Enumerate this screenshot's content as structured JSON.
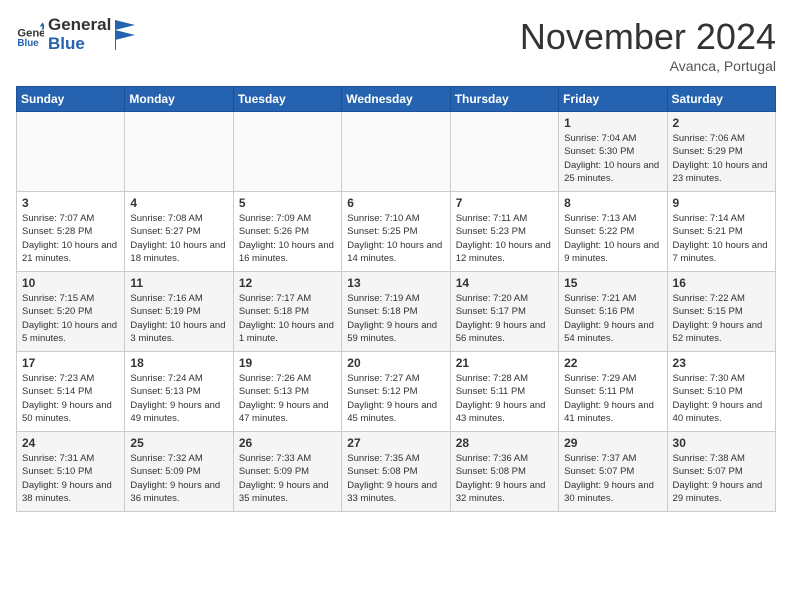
{
  "header": {
    "logo_general": "General",
    "logo_blue": "Blue",
    "month_title": "November 2024",
    "location": "Avanca, Portugal"
  },
  "weekdays": [
    "Sunday",
    "Monday",
    "Tuesday",
    "Wednesday",
    "Thursday",
    "Friday",
    "Saturday"
  ],
  "weeks": [
    [
      {
        "day": "",
        "info": ""
      },
      {
        "day": "",
        "info": ""
      },
      {
        "day": "",
        "info": ""
      },
      {
        "day": "",
        "info": ""
      },
      {
        "day": "",
        "info": ""
      },
      {
        "day": "1",
        "info": "Sunrise: 7:04 AM\nSunset: 5:30 PM\nDaylight: 10 hours and 25 minutes."
      },
      {
        "day": "2",
        "info": "Sunrise: 7:06 AM\nSunset: 5:29 PM\nDaylight: 10 hours and 23 minutes."
      }
    ],
    [
      {
        "day": "3",
        "info": "Sunrise: 7:07 AM\nSunset: 5:28 PM\nDaylight: 10 hours and 21 minutes."
      },
      {
        "day": "4",
        "info": "Sunrise: 7:08 AM\nSunset: 5:27 PM\nDaylight: 10 hours and 18 minutes."
      },
      {
        "day": "5",
        "info": "Sunrise: 7:09 AM\nSunset: 5:26 PM\nDaylight: 10 hours and 16 minutes."
      },
      {
        "day": "6",
        "info": "Sunrise: 7:10 AM\nSunset: 5:25 PM\nDaylight: 10 hours and 14 minutes."
      },
      {
        "day": "7",
        "info": "Sunrise: 7:11 AM\nSunset: 5:23 PM\nDaylight: 10 hours and 12 minutes."
      },
      {
        "day": "8",
        "info": "Sunrise: 7:13 AM\nSunset: 5:22 PM\nDaylight: 10 hours and 9 minutes."
      },
      {
        "day": "9",
        "info": "Sunrise: 7:14 AM\nSunset: 5:21 PM\nDaylight: 10 hours and 7 minutes."
      }
    ],
    [
      {
        "day": "10",
        "info": "Sunrise: 7:15 AM\nSunset: 5:20 PM\nDaylight: 10 hours and 5 minutes."
      },
      {
        "day": "11",
        "info": "Sunrise: 7:16 AM\nSunset: 5:19 PM\nDaylight: 10 hours and 3 minutes."
      },
      {
        "day": "12",
        "info": "Sunrise: 7:17 AM\nSunset: 5:18 PM\nDaylight: 10 hours and 1 minute."
      },
      {
        "day": "13",
        "info": "Sunrise: 7:19 AM\nSunset: 5:18 PM\nDaylight: 9 hours and 59 minutes."
      },
      {
        "day": "14",
        "info": "Sunrise: 7:20 AM\nSunset: 5:17 PM\nDaylight: 9 hours and 56 minutes."
      },
      {
        "day": "15",
        "info": "Sunrise: 7:21 AM\nSunset: 5:16 PM\nDaylight: 9 hours and 54 minutes."
      },
      {
        "day": "16",
        "info": "Sunrise: 7:22 AM\nSunset: 5:15 PM\nDaylight: 9 hours and 52 minutes."
      }
    ],
    [
      {
        "day": "17",
        "info": "Sunrise: 7:23 AM\nSunset: 5:14 PM\nDaylight: 9 hours and 50 minutes."
      },
      {
        "day": "18",
        "info": "Sunrise: 7:24 AM\nSunset: 5:13 PM\nDaylight: 9 hours and 49 minutes."
      },
      {
        "day": "19",
        "info": "Sunrise: 7:26 AM\nSunset: 5:13 PM\nDaylight: 9 hours and 47 minutes."
      },
      {
        "day": "20",
        "info": "Sunrise: 7:27 AM\nSunset: 5:12 PM\nDaylight: 9 hours and 45 minutes."
      },
      {
        "day": "21",
        "info": "Sunrise: 7:28 AM\nSunset: 5:11 PM\nDaylight: 9 hours and 43 minutes."
      },
      {
        "day": "22",
        "info": "Sunrise: 7:29 AM\nSunset: 5:11 PM\nDaylight: 9 hours and 41 minutes."
      },
      {
        "day": "23",
        "info": "Sunrise: 7:30 AM\nSunset: 5:10 PM\nDaylight: 9 hours and 40 minutes."
      }
    ],
    [
      {
        "day": "24",
        "info": "Sunrise: 7:31 AM\nSunset: 5:10 PM\nDaylight: 9 hours and 38 minutes."
      },
      {
        "day": "25",
        "info": "Sunrise: 7:32 AM\nSunset: 5:09 PM\nDaylight: 9 hours and 36 minutes."
      },
      {
        "day": "26",
        "info": "Sunrise: 7:33 AM\nSunset: 5:09 PM\nDaylight: 9 hours and 35 minutes."
      },
      {
        "day": "27",
        "info": "Sunrise: 7:35 AM\nSunset: 5:08 PM\nDaylight: 9 hours and 33 minutes."
      },
      {
        "day": "28",
        "info": "Sunrise: 7:36 AM\nSunset: 5:08 PM\nDaylight: 9 hours and 32 minutes."
      },
      {
        "day": "29",
        "info": "Sunrise: 7:37 AM\nSunset: 5:07 PM\nDaylight: 9 hours and 30 minutes."
      },
      {
        "day": "30",
        "info": "Sunrise: 7:38 AM\nSunset: 5:07 PM\nDaylight: 9 hours and 29 minutes."
      }
    ]
  ]
}
